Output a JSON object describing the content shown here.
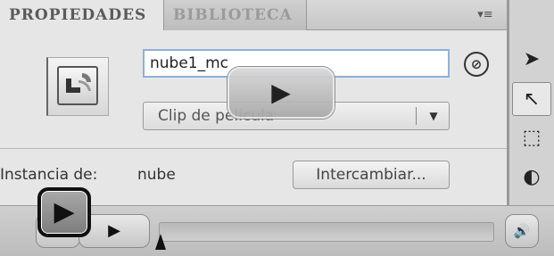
{
  "tabs": [
    {
      "label": "PROPIEDADES",
      "active": true
    },
    {
      "label": "BIBLIOTECA",
      "active": false
    }
  ],
  "panel_menu_icon": "▾≡",
  "instance": {
    "name_value": "nube1_mc",
    "type_selected": "Clip de película",
    "instance_of_label": "Instancia de:",
    "instance_of_value": "nube",
    "swap_label": "Intercambiar..."
  },
  "icons": {
    "edit": "⊘",
    "dropdown": "▼",
    "play": "▶",
    "volume": "🔊"
  },
  "tools": [
    {
      "name": "selection-tool",
      "glyph": "➤"
    },
    {
      "name": "subselection-tool",
      "glyph": "↖"
    },
    {
      "name": "free-transform-tool",
      "glyph": "⬚"
    },
    {
      "name": "3d-rotation-tool",
      "glyph": "◐"
    }
  ],
  "video": {
    "progress": 0
  }
}
